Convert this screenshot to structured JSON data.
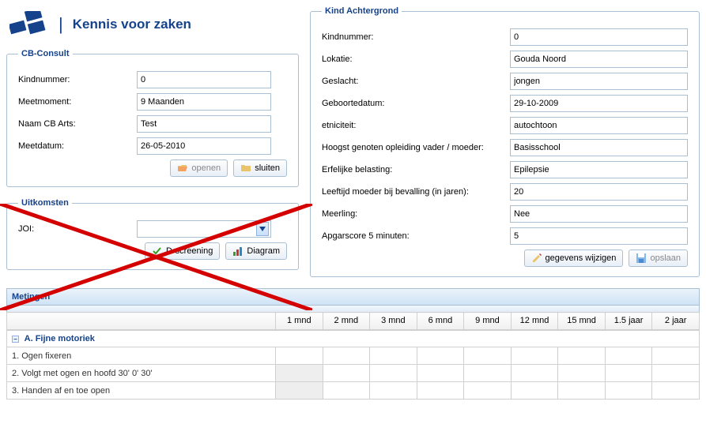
{
  "header": {
    "tagline": "Kennis voor zaken"
  },
  "cb_consult": {
    "legend": "CB-Consult",
    "rows": [
      {
        "label": "Kindnummer:",
        "value": "0"
      },
      {
        "label": "Meetmoment:",
        "value": "9 Maanden"
      },
      {
        "label": "Naam CB Arts:",
        "value": "Test"
      },
      {
        "label": "Meetdatum:",
        "value": "26-05-2010"
      }
    ],
    "btn_open": "openen",
    "btn_close": "sluiten"
  },
  "uitkomsten": {
    "legend": "Uitkomsten",
    "joi_label": "JOI:",
    "btn_dscreen": "D-screening",
    "btn_diagram": "Diagram"
  },
  "kind": {
    "legend": "Kind Achtergrond",
    "rows": [
      {
        "label": "Kindnummer:",
        "value": "0"
      },
      {
        "label": "Lokatie:",
        "value": "Gouda Noord"
      },
      {
        "label": "Geslacht:",
        "value": "jongen"
      },
      {
        "label": "Geboortedatum:",
        "value": "29-10-2009"
      },
      {
        "label": "etniciteit:",
        "value": "autochtoon"
      },
      {
        "label": "Hoogst genoten opleiding vader / moeder:",
        "value": "Basisschool"
      },
      {
        "label": "Erfelijke belasting:",
        "value": "Epilepsie"
      },
      {
        "label": "Leeftijd moeder bij bevalling (in jaren):",
        "value": "20"
      },
      {
        "label": "Meerling:",
        "value": "Nee"
      },
      {
        "label": "Apgarscore 5 minuten:",
        "value": "5"
      }
    ],
    "btn_edit": "gegevens wijzigen",
    "btn_save": "opslaan"
  },
  "metingen": {
    "title": "Metingen",
    "columns": [
      "1 mnd",
      "2 mnd",
      "3 mnd",
      "6 mnd",
      "9 mnd",
      "12 mnd",
      "15 mnd",
      "1.5 jaar",
      "2 jaar"
    ],
    "group": "A. Fijne motoriek",
    "items": [
      {
        "label": "1. Ogen fixeren",
        "shaded_from": -1
      },
      {
        "label": "2. Volgt met ogen en hoofd 30' 0' 30'",
        "shaded_from": 0
      },
      {
        "label": "3. Handen af en toe open",
        "shaded_from": 0
      }
    ]
  },
  "annotation": {
    "red_x": true
  }
}
